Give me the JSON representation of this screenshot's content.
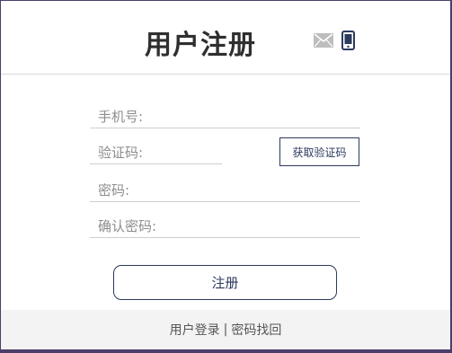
{
  "header": {
    "title": "用户注册",
    "icons": [
      "mail-icon",
      "phone-icon"
    ],
    "mail_icon_color": "#bdbdbd",
    "phone_icon_color": "#2c3a5e"
  },
  "form": {
    "phone_placeholder": "手机号:",
    "code_placeholder": "验证码:",
    "get_code_label": "获取验证码",
    "password_placeholder": "密码:",
    "confirm_placeholder": "确认密码:",
    "register_label": "注册"
  },
  "footer": {
    "login_link": "用户登录",
    "separator": "|",
    "recover_link": "密码找回"
  },
  "colors": {
    "accent": "#2c3a5e",
    "background": "#4a3f6b",
    "footer_bg": "#f3f3f3"
  }
}
